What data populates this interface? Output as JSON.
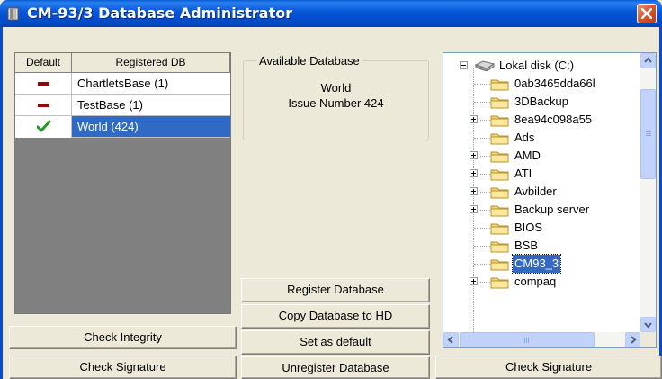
{
  "window": {
    "title": "CM-93/3 Database Administrator"
  },
  "registered_table": {
    "headers": {
      "default": "Default",
      "registered_db": "Registered DB"
    },
    "rows": [
      {
        "default_mark": "dash",
        "name": "ChartletsBase (1)",
        "selected": false
      },
      {
        "default_mark": "dash",
        "name": "TestBase (1)",
        "selected": false
      },
      {
        "default_mark": "check",
        "name": "World (424)",
        "selected": true
      }
    ]
  },
  "left_buttons": {
    "check_integrity": "Check Integrity",
    "check_signature": "Check Signature"
  },
  "available_database": {
    "legend": "Available Database",
    "name": "World",
    "issue": "Issue Number 424"
  },
  "middle_buttons": {
    "register": "Register Database",
    "copy_to_hd": "Copy Database to HD",
    "set_default": "Set as default",
    "unregister": "Unregister Database"
  },
  "folder_tree": {
    "root": "Lokal disk (C:)",
    "items": [
      {
        "label": "0ab3465dda66l",
        "expandable": false,
        "selected": false
      },
      {
        "label": "3DBackup",
        "expandable": false,
        "selected": false
      },
      {
        "label": "8ea94c098a55",
        "expandable": true,
        "selected": false
      },
      {
        "label": "Ads",
        "expandable": false,
        "selected": false
      },
      {
        "label": "AMD",
        "expandable": true,
        "selected": false
      },
      {
        "label": "ATI",
        "expandable": true,
        "selected": false
      },
      {
        "label": "Avbilder",
        "expandable": true,
        "selected": false
      },
      {
        "label": "Backup server",
        "expandable": true,
        "selected": false
      },
      {
        "label": "BIOS",
        "expandable": false,
        "selected": false
      },
      {
        "label": "BSB",
        "expandable": false,
        "selected": false
      },
      {
        "label": "CM93_3",
        "expandable": false,
        "selected": true
      },
      {
        "label": "compaq",
        "expandable": true,
        "selected": false
      }
    ]
  },
  "right_buttons": {
    "check_signature": "Check Signature"
  },
  "colors": {
    "titlebar": "#0555d8",
    "selection": "#316ac5",
    "panel_gray": "#808080",
    "default_dash": "#8c0a0a",
    "check_green": "#1e9a1e"
  }
}
